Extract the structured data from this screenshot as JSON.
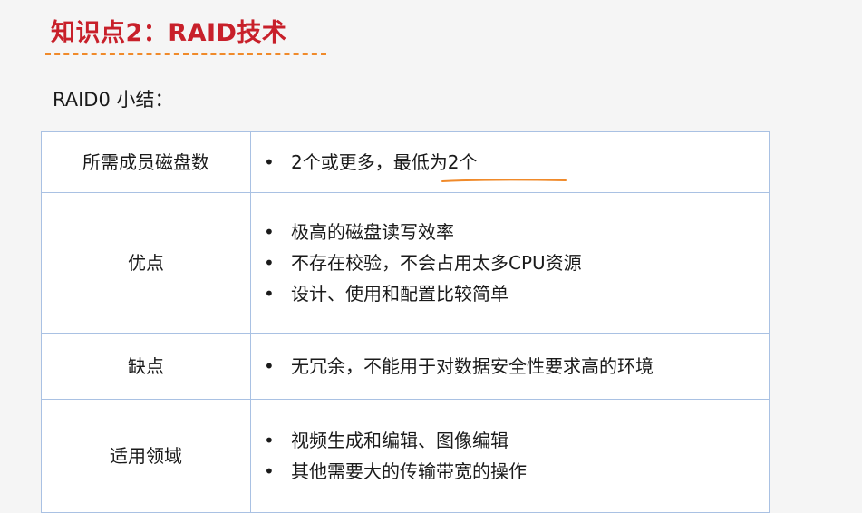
{
  "slide": {
    "title": "知识点2：RAID技术",
    "subtitle": "RAID0 小结："
  },
  "table": {
    "bullet_symbol": "•",
    "rows": [
      {
        "label": "所需成员磁盘数",
        "items": [
          "2个或更多，最低为2个"
        ]
      },
      {
        "label": "优点",
        "items": [
          "极高的磁盘读写效率",
          "不存在校验，不会占用太多CPU资源",
          "设计、使用和配置比较简单"
        ]
      },
      {
        "label": "缺点",
        "items": [
          "无冗余，不能用于对数据安全性要求高的环境"
        ]
      },
      {
        "label": "适用领域",
        "items": [
          "视频生成和编辑、图像编辑",
          "其他需要大的传输带宽的操作"
        ]
      }
    ]
  },
  "colors": {
    "title": "#c8202a",
    "title_underline": "#f08a2a",
    "table_border": "#a9c1e3",
    "annotation_stroke": "#f08a2a"
  }
}
